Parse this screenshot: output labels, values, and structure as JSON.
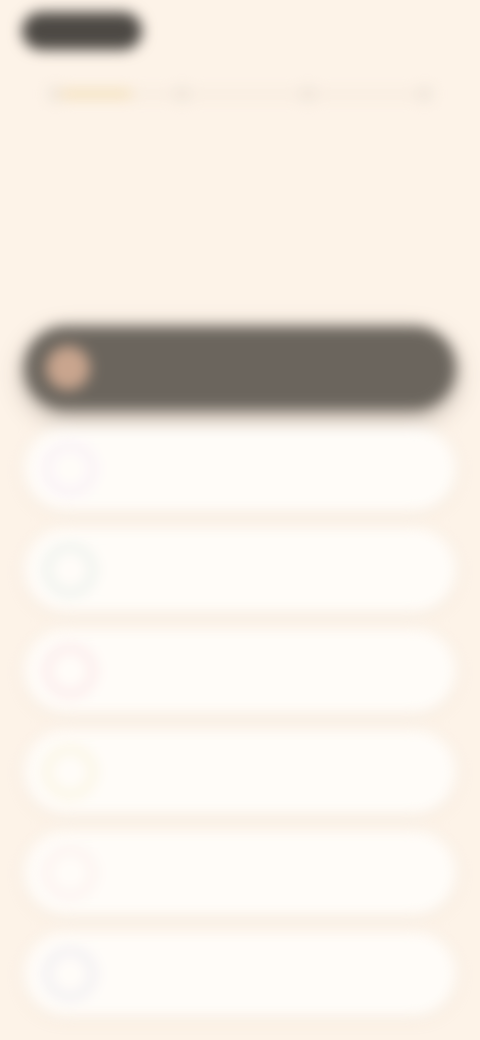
{
  "header": {
    "pill_color": "#4D4944"
  },
  "progress": {
    "value": 0.22,
    "steps": 4,
    "fill_color": "#F0D7A6"
  },
  "question": {
    "title": ""
  },
  "options": [
    {
      "label": "",
      "icon": "option-icon",
      "icon_color": "#C9A58E",
      "selected": true
    },
    {
      "label": "",
      "icon": "option-icon",
      "icon_color": "#E9CFF3",
      "selected": false
    },
    {
      "label": "",
      "icon": "option-icon",
      "icon_color": "#BDD6CE",
      "selected": false
    },
    {
      "label": "",
      "icon": "option-icon",
      "icon_color": "#F2B9C4",
      "selected": false
    },
    {
      "label": "",
      "icon": "option-icon",
      "icon_color": "#EFE2A8",
      "selected": false
    },
    {
      "label": "",
      "icon": "option-icon",
      "icon_color": "#F5D6D6",
      "selected": false
    },
    {
      "label": "",
      "icon": "option-icon",
      "icon_color": "#C9C8E2",
      "selected": false
    }
  ]
}
